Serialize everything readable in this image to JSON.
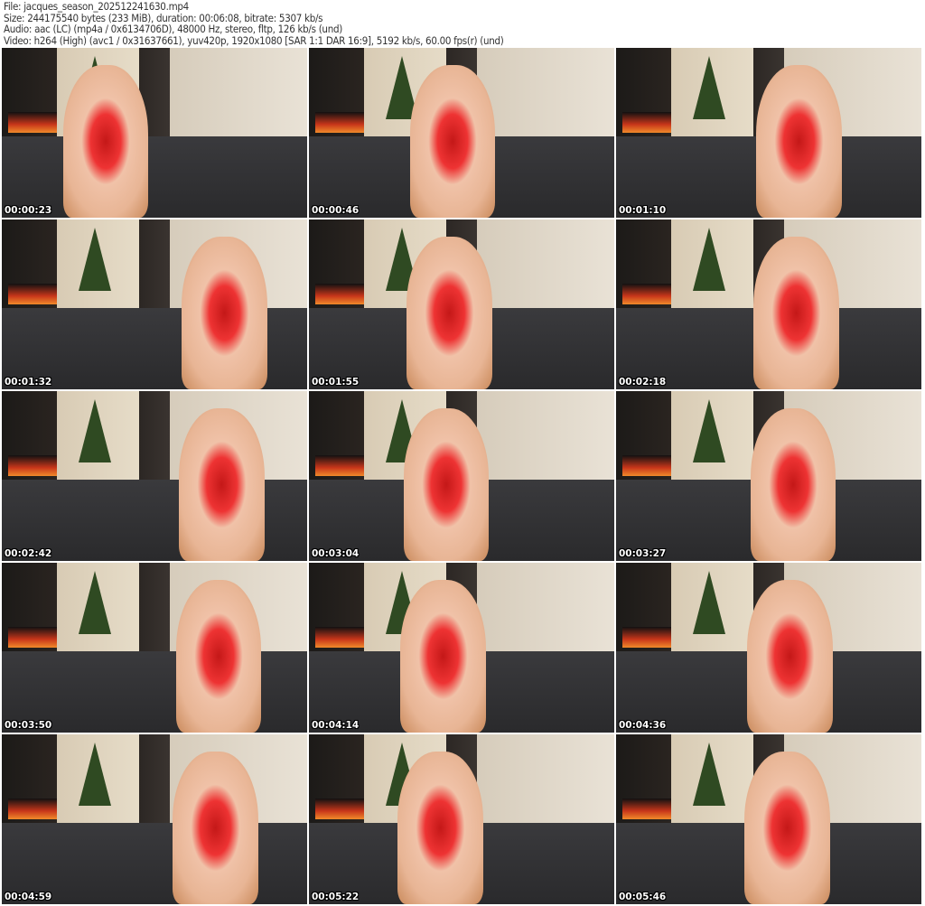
{
  "header": {
    "file": "File: jacques_season_202512241630.mp4",
    "size": "Size: 244175540 bytes (233 MiB), duration: 00:06:08, bitrate: 5307 kb/s",
    "audio": "Audio: aac (LC) (mp4a / 0x6134706D), 48000 Hz, stereo, fltp, 126 kb/s (und)",
    "video": "Video: h264 (High) (avc1 / 0x31637661), yuv420p, 1920x1080 [SAR 1:1 DAR 16:9], 5192 kb/s, 60.00 fps(r) (und)"
  },
  "thumbnails": [
    {
      "timestamp": "00:00:23"
    },
    {
      "timestamp": "00:00:46"
    },
    {
      "timestamp": "00:01:10"
    },
    {
      "timestamp": "00:01:32"
    },
    {
      "timestamp": "00:01:55"
    },
    {
      "timestamp": "00:02:18"
    },
    {
      "timestamp": "00:02:42"
    },
    {
      "timestamp": "00:03:04"
    },
    {
      "timestamp": "00:03:27"
    },
    {
      "timestamp": "00:03:50"
    },
    {
      "timestamp": "00:04:14"
    },
    {
      "timestamp": "00:04:36"
    },
    {
      "timestamp": "00:04:59"
    },
    {
      "timestamp": "00:05:22"
    },
    {
      "timestamp": "00:05:46"
    }
  ]
}
